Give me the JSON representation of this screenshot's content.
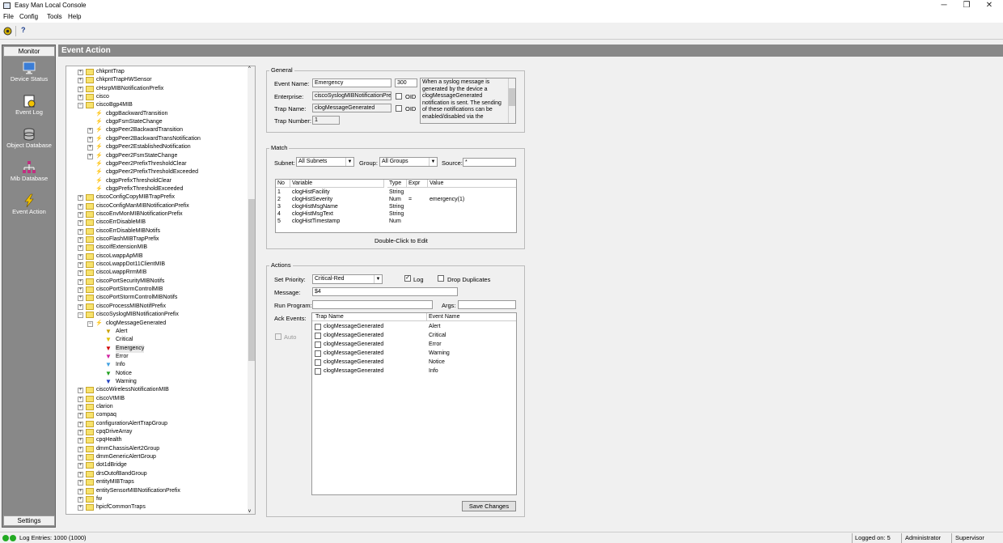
{
  "window": {
    "title": "Easy Man Local Console",
    "minimize": "─",
    "maximize": "❐",
    "close": "✕"
  },
  "menu": [
    "File",
    "Config",
    "Tools",
    "Help"
  ],
  "toolbar": {
    "help_label": "?"
  },
  "nav": {
    "header": "Monitor",
    "items": [
      "Device Status",
      "Event Log",
      "Object Database",
      "Mib Database",
      "Event Action"
    ],
    "footer": "Settings"
  },
  "page_title": "Event Action",
  "tree": [
    {
      "lvl": 0,
      "t": "folder",
      "e": "+",
      "label": "chkpntTrap"
    },
    {
      "lvl": 0,
      "t": "folder",
      "e": "+",
      "label": "chkpntTrapHWSensor"
    },
    {
      "lvl": 0,
      "t": "folder",
      "e": "+",
      "label": "cHsrpMIBNotificationPrefix"
    },
    {
      "lvl": 0,
      "t": "folder",
      "e": "+",
      "label": "cisco"
    },
    {
      "lvl": 0,
      "t": "folder",
      "e": "-",
      "label": "ciscoBgp4MIB"
    },
    {
      "lvl": 1,
      "t": "trap",
      "e": "",
      "label": "cbgpBackwardTransition"
    },
    {
      "lvl": 1,
      "t": "trap",
      "e": "",
      "label": "cbgpFsmStateChange"
    },
    {
      "lvl": 1,
      "t": "trap",
      "e": "+",
      "label": "cbgpPeer2BackwardTransition"
    },
    {
      "lvl": 1,
      "t": "trap",
      "e": "+",
      "label": "cbgpPeer2BackwardTransNotification"
    },
    {
      "lvl": 1,
      "t": "trap",
      "e": "+",
      "label": "cbgpPeer2EstablishedNotification"
    },
    {
      "lvl": 1,
      "t": "trap",
      "e": "+",
      "label": "cbgpPeer2FsmStateChange"
    },
    {
      "lvl": 1,
      "t": "trap",
      "e": "",
      "label": "cbgpPeer2PrefixThresholdClear"
    },
    {
      "lvl": 1,
      "t": "trap",
      "e": "",
      "label": "cbgpPeer2PrefixThresholdExceeded"
    },
    {
      "lvl": 1,
      "t": "trap",
      "e": "",
      "label": "cbgpPrefixThresholdClear"
    },
    {
      "lvl": 1,
      "t": "trap",
      "e": "",
      "label": "cbgpPrefixThresholdExceeded"
    },
    {
      "lvl": 0,
      "t": "folder",
      "e": "+",
      "label": "ciscoConfigCopyMIBTrapPrefix"
    },
    {
      "lvl": 0,
      "t": "folder",
      "e": "+",
      "label": "ciscoConfigManMIBNotificationPrefix"
    },
    {
      "lvl": 0,
      "t": "folder",
      "e": "+",
      "label": "ciscoEnvMonMIBNotificationPrefix"
    },
    {
      "lvl": 0,
      "t": "folder",
      "e": "+",
      "label": "ciscoErrDisableMIB"
    },
    {
      "lvl": 0,
      "t": "folder",
      "e": "+",
      "label": "ciscoErrDisableMIBNotifs"
    },
    {
      "lvl": 0,
      "t": "folder",
      "e": "+",
      "label": "ciscoFlashMIBTrapPrefix"
    },
    {
      "lvl": 0,
      "t": "folder",
      "e": "+",
      "label": "ciscoIfExtensionMIB"
    },
    {
      "lvl": 0,
      "t": "folder",
      "e": "+",
      "label": "ciscoLwappApMIB"
    },
    {
      "lvl": 0,
      "t": "folder",
      "e": "+",
      "label": "ciscoLwappDot11ClientMIB"
    },
    {
      "lvl": 0,
      "t": "folder",
      "e": "+",
      "label": "ciscoLwappRrmMIB"
    },
    {
      "lvl": 0,
      "t": "folder",
      "e": "+",
      "label": "ciscoPortSecurityMIBNotifs"
    },
    {
      "lvl": 0,
      "t": "folder",
      "e": "+",
      "label": "ciscoPortStormControlMIB"
    },
    {
      "lvl": 0,
      "t": "folder",
      "e": "+",
      "label": "ciscoPortStormControlMIBNotifs"
    },
    {
      "lvl": 0,
      "t": "folder",
      "e": "+",
      "label": "ciscoProcessMIBNotifPrefix"
    },
    {
      "lvl": 0,
      "t": "folder",
      "e": "-",
      "label": "ciscoSyslogMIBNotificationPrefix"
    },
    {
      "lvl": 1,
      "t": "trap",
      "e": "-",
      "label": "clogMessageGenerated"
    },
    {
      "lvl": 2,
      "t": "filter",
      "c": "#c8a000",
      "e": "",
      "label": "Alert"
    },
    {
      "lvl": 2,
      "t": "filter",
      "c": "#e0c000",
      "e": "",
      "label": "Critical"
    },
    {
      "lvl": 2,
      "t": "filter",
      "c": "#d00000",
      "e": "",
      "label": "Emergency"
    },
    {
      "lvl": 2,
      "t": "filter",
      "c": "#d020a0",
      "e": "",
      "label": "Error"
    },
    {
      "lvl": 2,
      "t": "filter",
      "c": "#40a0e0",
      "e": "",
      "label": "Info"
    },
    {
      "lvl": 2,
      "t": "filter",
      "c": "#20a020",
      "e": "",
      "label": "Notice"
    },
    {
      "lvl": 2,
      "t": "filter",
      "c": "#2040c0",
      "e": "",
      "label": "Warning"
    },
    {
      "lvl": 0,
      "t": "folder",
      "e": "+",
      "label": "ciscoWirelessNotificationMIB"
    },
    {
      "lvl": 0,
      "t": "folder",
      "e": "+",
      "label": "ciscoVtMIB"
    },
    {
      "lvl": 0,
      "t": "folder",
      "e": "+",
      "label": "clarion"
    },
    {
      "lvl": 0,
      "t": "folder",
      "e": "+",
      "label": "compaq"
    },
    {
      "lvl": 0,
      "t": "folder",
      "e": "+",
      "label": "configurationAlertTrapGroup"
    },
    {
      "lvl": 0,
      "t": "folder",
      "e": "+",
      "label": "cpqDriveArray"
    },
    {
      "lvl": 0,
      "t": "folder",
      "e": "+",
      "label": "cpqHealth"
    },
    {
      "lvl": 0,
      "t": "folder",
      "e": "+",
      "label": "dmmChassisAlert2Group"
    },
    {
      "lvl": 0,
      "t": "folder",
      "e": "+",
      "label": "dmmGenericAlertGroup"
    },
    {
      "lvl": 0,
      "t": "folder",
      "e": "+",
      "label": "dot1dBridge"
    },
    {
      "lvl": 0,
      "t": "folder",
      "e": "+",
      "label": "drsOutofBandGroup"
    },
    {
      "lvl": 0,
      "t": "folder",
      "e": "+",
      "label": "entityMIBTraps"
    },
    {
      "lvl": 0,
      "t": "folder",
      "e": "+",
      "label": "entitySensorMIBNotificationPrefix"
    },
    {
      "lvl": 0,
      "t": "folder",
      "e": "+",
      "label": "fw"
    },
    {
      "lvl": 0,
      "t": "folder",
      "e": "+",
      "label": "hpicfCommonTraps"
    }
  ],
  "general": {
    "legend": "General",
    "event_name_label": "Event Name:",
    "event_name": "Emergency",
    "event_id": "300",
    "description": "When a syslog message is generated by the device a clogMessageGenerated notification is sent. The sending of these notifications can be enabled/disabled via the",
    "enterprise_label": "Enterprise:",
    "enterprise": "ciscoSyslogMIBNotificationPref",
    "trap_name_label": "Trap Name:",
    "trap_name": "clogMessageGenerated",
    "trap_number_label": "Trap Number:",
    "trap_number": "1",
    "oid_label": "OID"
  },
  "match": {
    "legend": "Match",
    "subnet_label": "Subnet:",
    "subnet": "All Subnets",
    "group_label": "Group:",
    "group": "All Groups",
    "source_label": "Source:",
    "source": "*",
    "columns": [
      "No",
      "Variable",
      "Type",
      "Expr",
      "Value"
    ],
    "rows": [
      [
        "1",
        "clogHistFacility",
        "String",
        "",
        ""
      ],
      [
        "2",
        "clogHistSeverity",
        "Num",
        "=",
        "emergency(1)"
      ],
      [
        "3",
        "clogHistMsgName",
        "String",
        "",
        ""
      ],
      [
        "4",
        "clogHistMsgText",
        "String",
        "",
        ""
      ],
      [
        "5",
        "clogHistTimestamp",
        "Num",
        "",
        ""
      ]
    ],
    "hint": "Double-Click to Edit"
  },
  "actions": {
    "legend": "Actions",
    "priority_label": "Set Priority:",
    "priority": "Critical-Red",
    "log_label": "Log",
    "log_checked": true,
    "drop_label": "Drop Duplicates",
    "drop_checked": false,
    "message_label": "Message:",
    "message": "$4",
    "run_label": "Run Program:",
    "run": "",
    "args_label": "Args:",
    "args": "",
    "ack_label": "Ack Events:",
    "auto_label": "Auto",
    "columns": [
      "Trap Name",
      "Event Name"
    ],
    "rows": [
      [
        "clogMessageGenerated",
        "Alert"
      ],
      [
        "clogMessageGenerated",
        "Critical"
      ],
      [
        "clogMessageGenerated",
        "Error"
      ],
      [
        "clogMessageGenerated",
        "Warning"
      ],
      [
        "clogMessageGenerated",
        "Notice"
      ],
      [
        "clogMessageGenerated",
        "Info"
      ]
    ],
    "save_label": "Save Changes"
  },
  "status": {
    "log_entries": "Log Entries: 1000 (1000)",
    "logged_on": "Logged on: 5",
    "role": "Administrator",
    "user": "Supervisor"
  }
}
